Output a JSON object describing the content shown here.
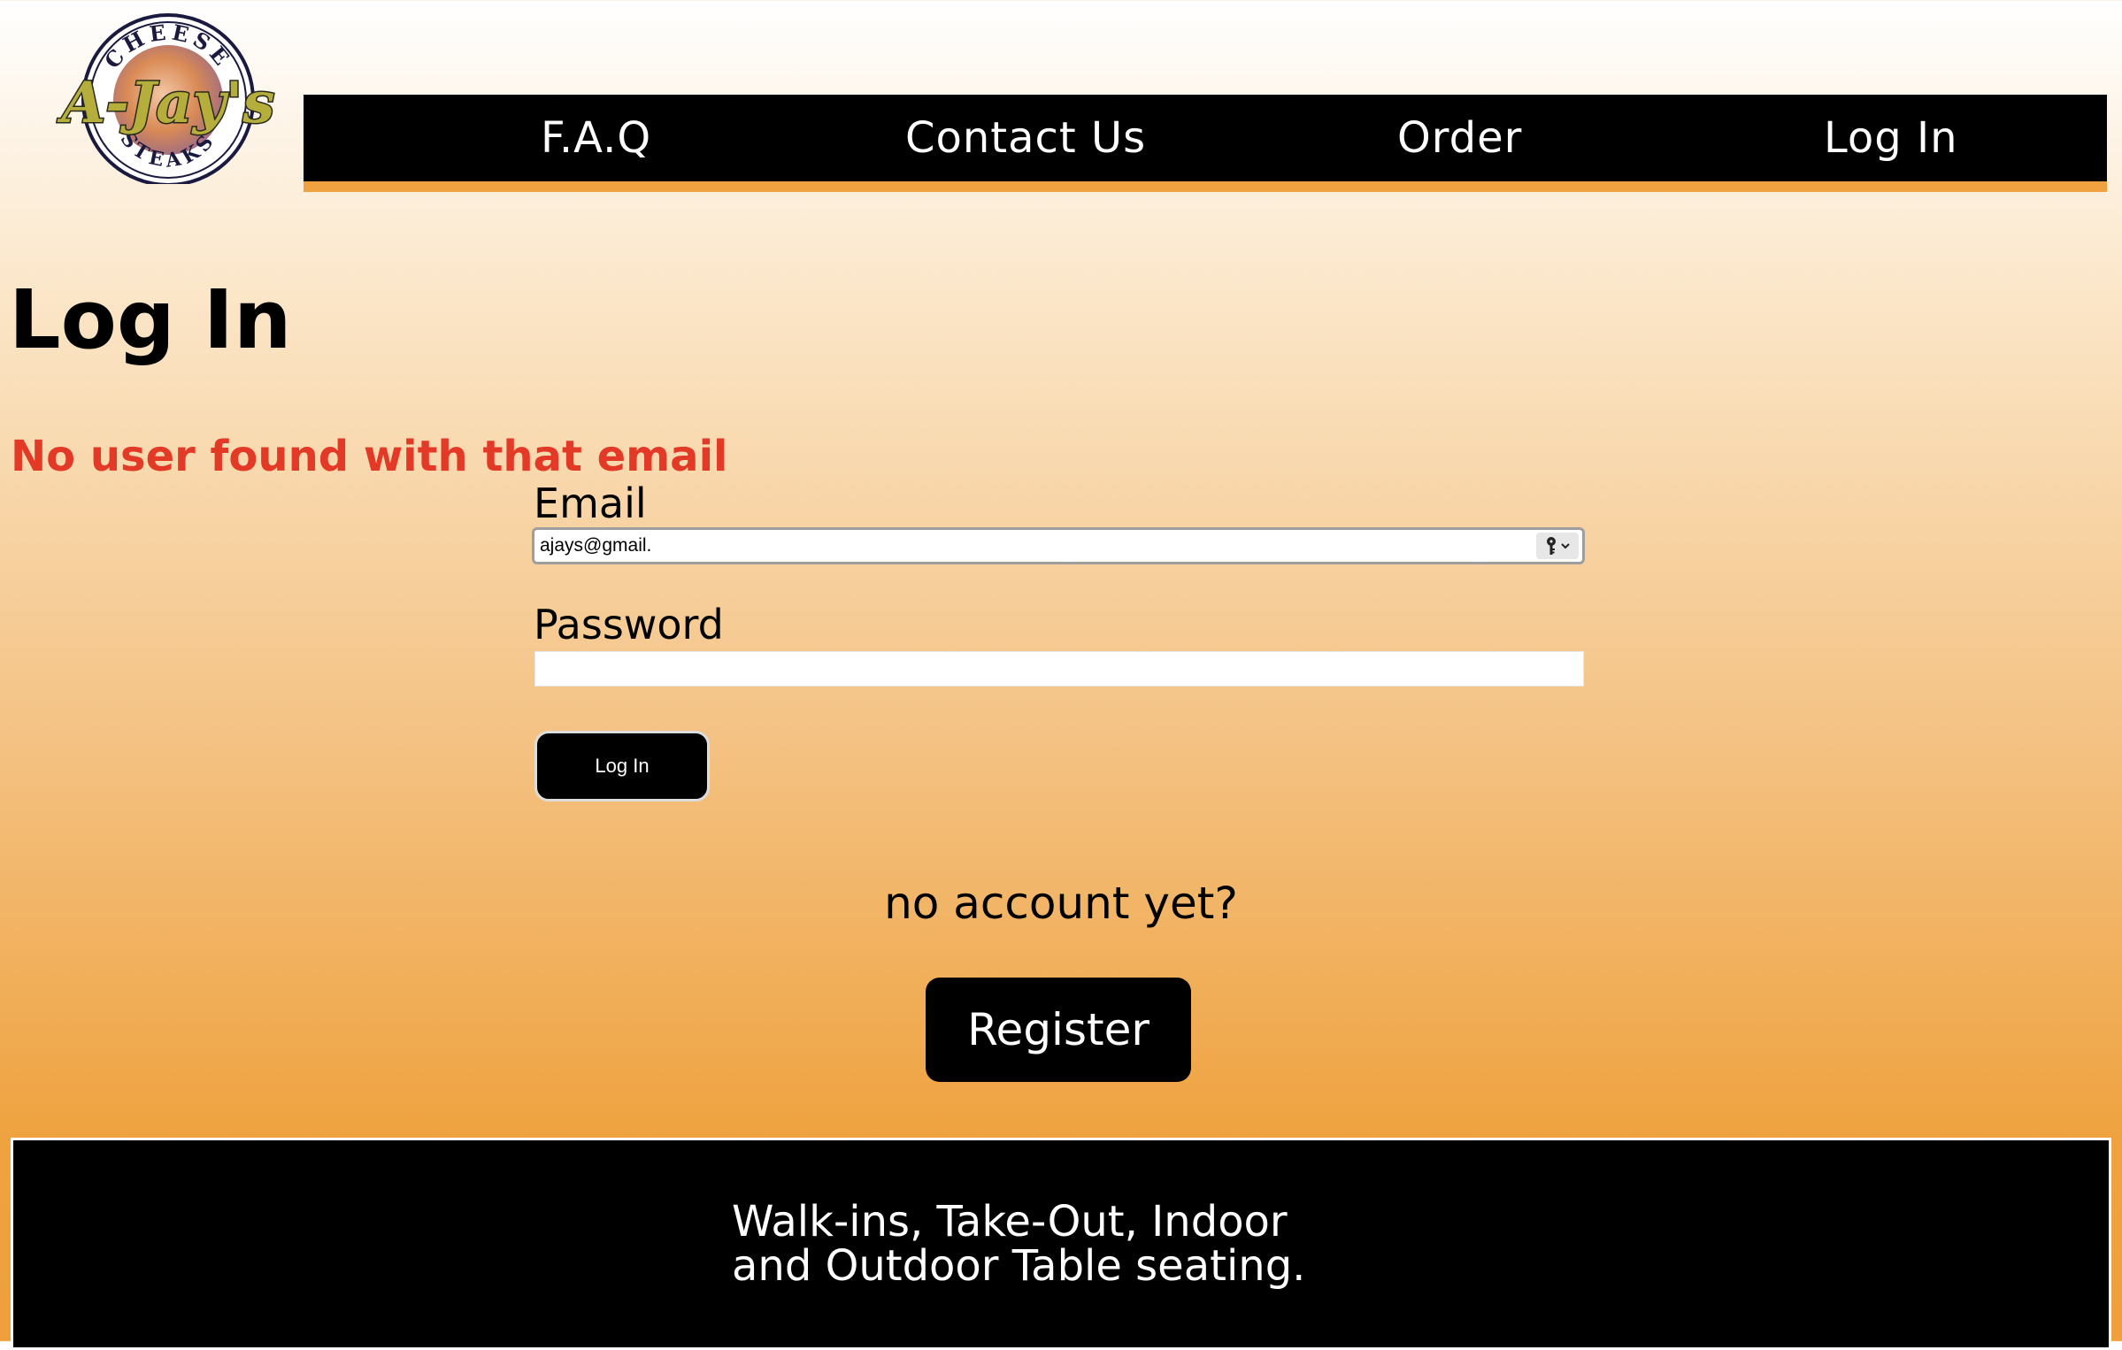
{
  "logo": {
    "icon": "ajays-cheese-steaks-logo",
    "top_text": "CHEESE",
    "main_text": "A-Jay's",
    "bottom_text": "STEAKS"
  },
  "nav": {
    "items": [
      {
        "label": "F.A.Q"
      },
      {
        "label": "Contact Us"
      },
      {
        "label": "Order"
      },
      {
        "label": "Log In"
      }
    ]
  },
  "page": {
    "title": "Log In",
    "error": "No user found with that email"
  },
  "form": {
    "email_label": "Email",
    "email_value": "ajays@gmail.",
    "password_label": "Password",
    "password_value": "",
    "submit_label": "Log In",
    "password_manager_icon": "key-icon"
  },
  "register": {
    "prompt": "no account yet?",
    "button_label": "Register"
  },
  "footer": {
    "line1": "Walk-ins, Take-Out, Indoor",
    "line2": "and Outdoor Table seating."
  },
  "colors": {
    "nav_bg": "#000000",
    "nav_accent": "#efa23f",
    "error": "#e33a28",
    "gradient_top": "#ffffff",
    "gradient_bottom": "#efa03d"
  }
}
